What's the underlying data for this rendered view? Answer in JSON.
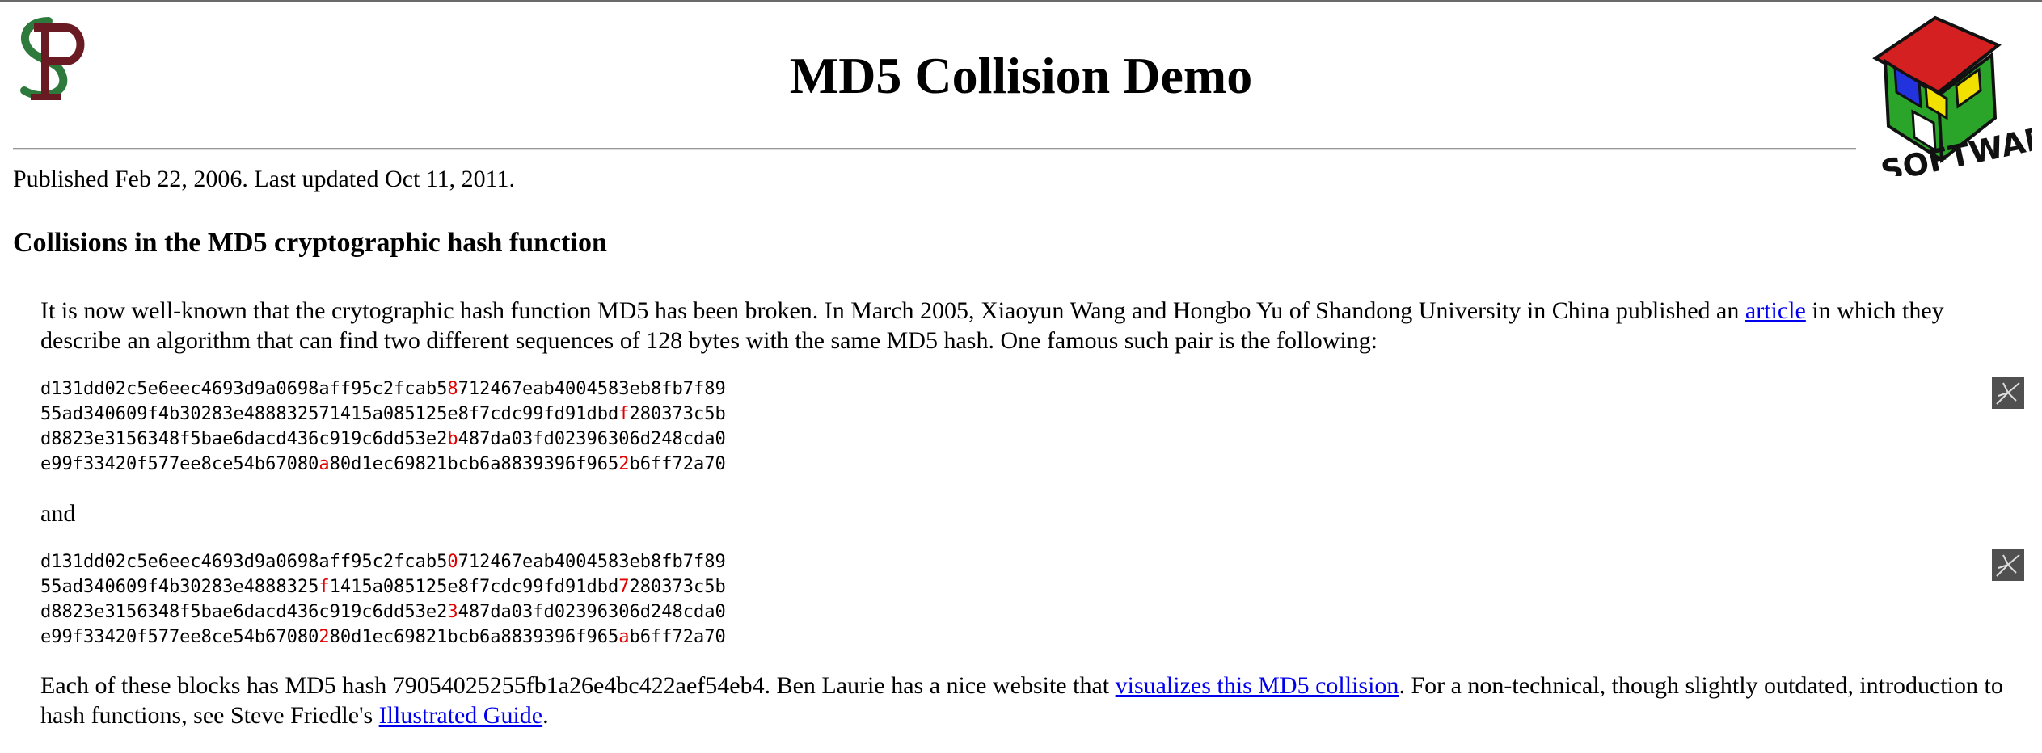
{
  "header": {
    "title": "MD5 Collision Demo",
    "published": "Published Feb 22, 2006. Last updated Oct 11, 2011."
  },
  "section": {
    "heading": "Collisions in the MD5 cryptographic hash function"
  },
  "intro": {
    "text_before_link": "It is now well-known that the crytographic hash function MD5 has been broken. In March 2005, Xiaoyun Wang and Hongbo Yu of Shandong University in China published an ",
    "link_text": "article",
    "text_after_link": " in which they describe an algorithm that can find two different sequences of 128 bytes with the same MD5 hash. One famous such pair is the following:"
  },
  "block1": {
    "lines": [
      {
        "pre": "d131dd02c5e6eec4693d9a0698aff95c2fcab5",
        "red": "8",
        "post": "712467eab4004583eb8fb7f89",
        "red2": "",
        "post2": ""
      },
      {
        "pre": "55ad340609f4b30283e48883257",
        "red": "",
        "post": "1415a085125e8f7cdc99fd91dbd",
        "red2": "f",
        "post2": "280373c5b"
      },
      {
        "pre": "d8823e3156348f5bae6dacd436c919c6dd53e2",
        "red": "b",
        "post": "487da03fd02396306d248cda0",
        "red2": "",
        "post2": ""
      },
      {
        "pre": "e99f33420f577ee8ce54b67080",
        "red": "a",
        "post": "80d1ec69821bcb6a8839396f965",
        "red2": "2",
        "post2": "b6ff72a70"
      }
    ]
  },
  "and_text": "and",
  "block2": {
    "lines": [
      {
        "pre": "d131dd02c5e6eec4693d9a0698aff95c2fcab5",
        "red": "0",
        "post": "712467eab4004583eb8fb7f89",
        "red2": "",
        "post2": ""
      },
      {
        "pre": "55ad340609f4b30283e4888325",
        "red": "f",
        "post": "1415a085125e8f7cdc99fd91dbd",
        "red2": "7",
        "post2": "280373c5b"
      },
      {
        "pre": "d8823e3156348f5bae6dacd436c919c6dd53e2",
        "red": "3",
        "post": "487da03fd02396306d248cda0",
        "red2": "",
        "post2": ""
      },
      {
        "pre": "e99f33420f577ee8ce54b67080",
        "red": "2",
        "post": "80d1ec69821bcb6a8839396f965",
        "red2": "a",
        "post2": "b6ff72a70"
      }
    ]
  },
  "outro": {
    "text1": "Each of these blocks has MD5 hash 79054025255fb1a26e4bc422aef54eb4. Ben Laurie has a nice website that ",
    "link1": "visualizes this MD5 collision",
    "text2": ". For a non-technical, though slightly outdated, introduction to hash functions, see Steve Friedle's ",
    "link2": "Illustrated Guide",
    "text3": "."
  },
  "logos": {
    "right_logo_text": "SOFTWARE"
  },
  "colors": {
    "link": "#0000ee",
    "highlight": "#e00000"
  }
}
